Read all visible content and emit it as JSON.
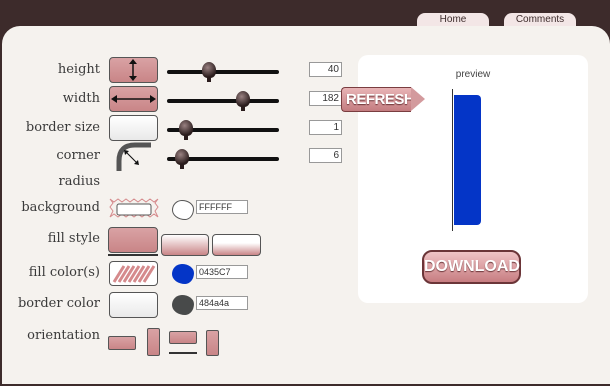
{
  "nav": {
    "home": "Home",
    "comments": "Comments"
  },
  "labels": {
    "height": "height",
    "width": "width",
    "border_size": "border size",
    "corner": "corner",
    "radius": "radius",
    "background": "background",
    "fill_style": "fill style",
    "fill_colors": "fill color(s)",
    "border_color": "border color",
    "orientation": "orientation"
  },
  "values": {
    "height": "40",
    "width": "182",
    "border_size": "1",
    "corner_radius": "6",
    "background_hex": "FFFFFF",
    "fill_hex": "0435C7",
    "border_hex": "484a4a"
  },
  "colors": {
    "fill": "#0435c7",
    "border": "#484a4a",
    "background": "#ffffff",
    "accent": "#c98587"
  },
  "buttons": {
    "refresh": "REFRESH",
    "download": "DOWNLOAD"
  },
  "preview": {
    "title": "preview"
  }
}
